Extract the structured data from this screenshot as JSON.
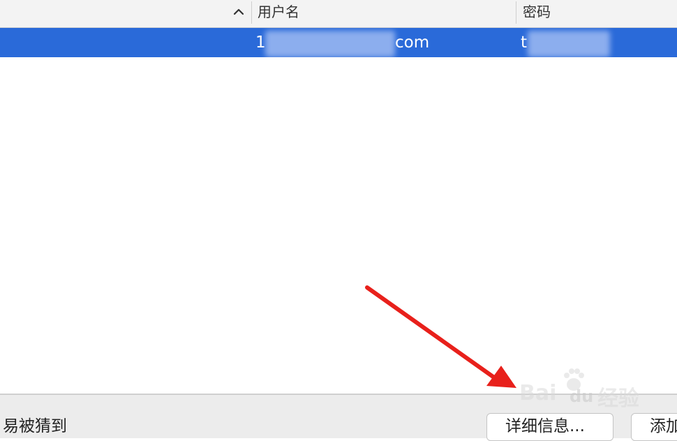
{
  "table": {
    "columns": [
      {
        "label": ""
      },
      {
        "label": "用户名"
      },
      {
        "label": "密码"
      }
    ],
    "sort_indicator": "sort-ascending-chevron",
    "rows": [
      {
        "username_visible_start": "1",
        "username_visible_end": "com",
        "password_visible_start": "t",
        "selected": true
      }
    ]
  },
  "footer": {
    "hint_text": "易被猜到",
    "details_button_label": "详细信息...",
    "add_button_label": "添加"
  },
  "watermark": {
    "text_latin": "Bai",
    "text_du": "du",
    "text_cn": "经验"
  },
  "colors": {
    "selection": "#2a6ad9",
    "arrow": "#e8201b"
  }
}
